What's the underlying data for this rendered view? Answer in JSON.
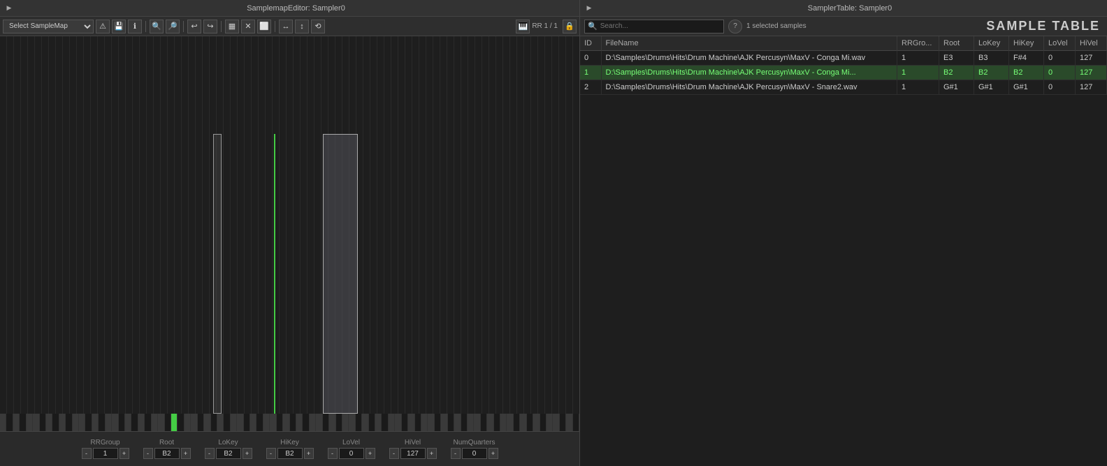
{
  "left_panel": {
    "title": "SamplemapEditor: Sampler0",
    "toolbar": {
      "select_placeholder": "Select SampleMap",
      "rr_label": "RR 1 / 1",
      "buttons": [
        "▶",
        "⬜",
        "⚠",
        "💾",
        "ℹ",
        "🔍+",
        "🔍-",
        "↩",
        "↪",
        "▦",
        "✕",
        "⬜",
        "↔",
        "↕",
        "⟲"
      ]
    },
    "controls": [
      {
        "label": "RRGroup",
        "minus": "-",
        "value": "1",
        "plus": "+"
      },
      {
        "label": "Root",
        "minus": "-",
        "value": "B2",
        "plus": "+"
      },
      {
        "label": "LoKey",
        "minus": "-",
        "value": "B2",
        "plus": "+"
      },
      {
        "label": "HiKey",
        "minus": "-",
        "value": "B2",
        "plus": "+"
      },
      {
        "label": "LoVel",
        "minus": "-",
        "value": "0",
        "plus": "+"
      },
      {
        "label": "HiVel",
        "minus": "-",
        "value": "127",
        "plus": "+"
      },
      {
        "label": "NumQuarters",
        "minus": "-",
        "value": "0",
        "plus": "+"
      }
    ]
  },
  "right_panel": {
    "title": "SamplerTable: Sampler0",
    "table_title": "SAMPLE TABLE",
    "search_placeholder": "Search...",
    "selected_count": "1 selected samples",
    "columns": [
      "ID",
      "FileName",
      "RRGro...",
      "Root",
      "LoKey",
      "HiKey",
      "LoVel",
      "HiVel"
    ],
    "rows": [
      {
        "id": "0",
        "filename": "D:\\Samples\\Drums\\Hits\\Drum Machine\\AJK Percusyn\\MaxV - Conga Mi.wav",
        "filename_display": "D:\\Samples\\Drums\\Hits\\Drum Machine\\AJK Percusyn\\MaxV - Conga Mi.wav",
        "rrgroup": "1",
        "root": "E3",
        "lokey": "B3",
        "hikey": "F#4",
        "lovel": "0",
        "hivel": "127",
        "selected": false
      },
      {
        "id": "1",
        "filename": "D:\\Samples\\Drums\\Hits\\Drum Machine\\AJK Percusyn\\MaxV - Conga Mi...",
        "filename_display": "D:\\Samples\\Drums\\Hits\\Drum Machine\\AJK Percusyn\\MaxV - Conga Mi...",
        "rrgroup": "1",
        "root": "B2",
        "lokey": "B2",
        "hikey": "B2",
        "lovel": "0",
        "hivel": "127",
        "selected": true
      },
      {
        "id": "2",
        "filename": "D:\\Samples\\Drums\\Hits\\Drum Machine\\AJK Percusyn\\MaxV - Snare2.wav",
        "filename_display": "D:\\Samples\\Drums\\Hits\\Drum Machine\\AJK Percusyn\\MaxV - Snare2.wav",
        "rrgroup": "1",
        "root": "G#1",
        "lokey": "G#1",
        "hikey": "G#1",
        "lovel": "0",
        "hivel": "127",
        "selected": false
      }
    ]
  }
}
